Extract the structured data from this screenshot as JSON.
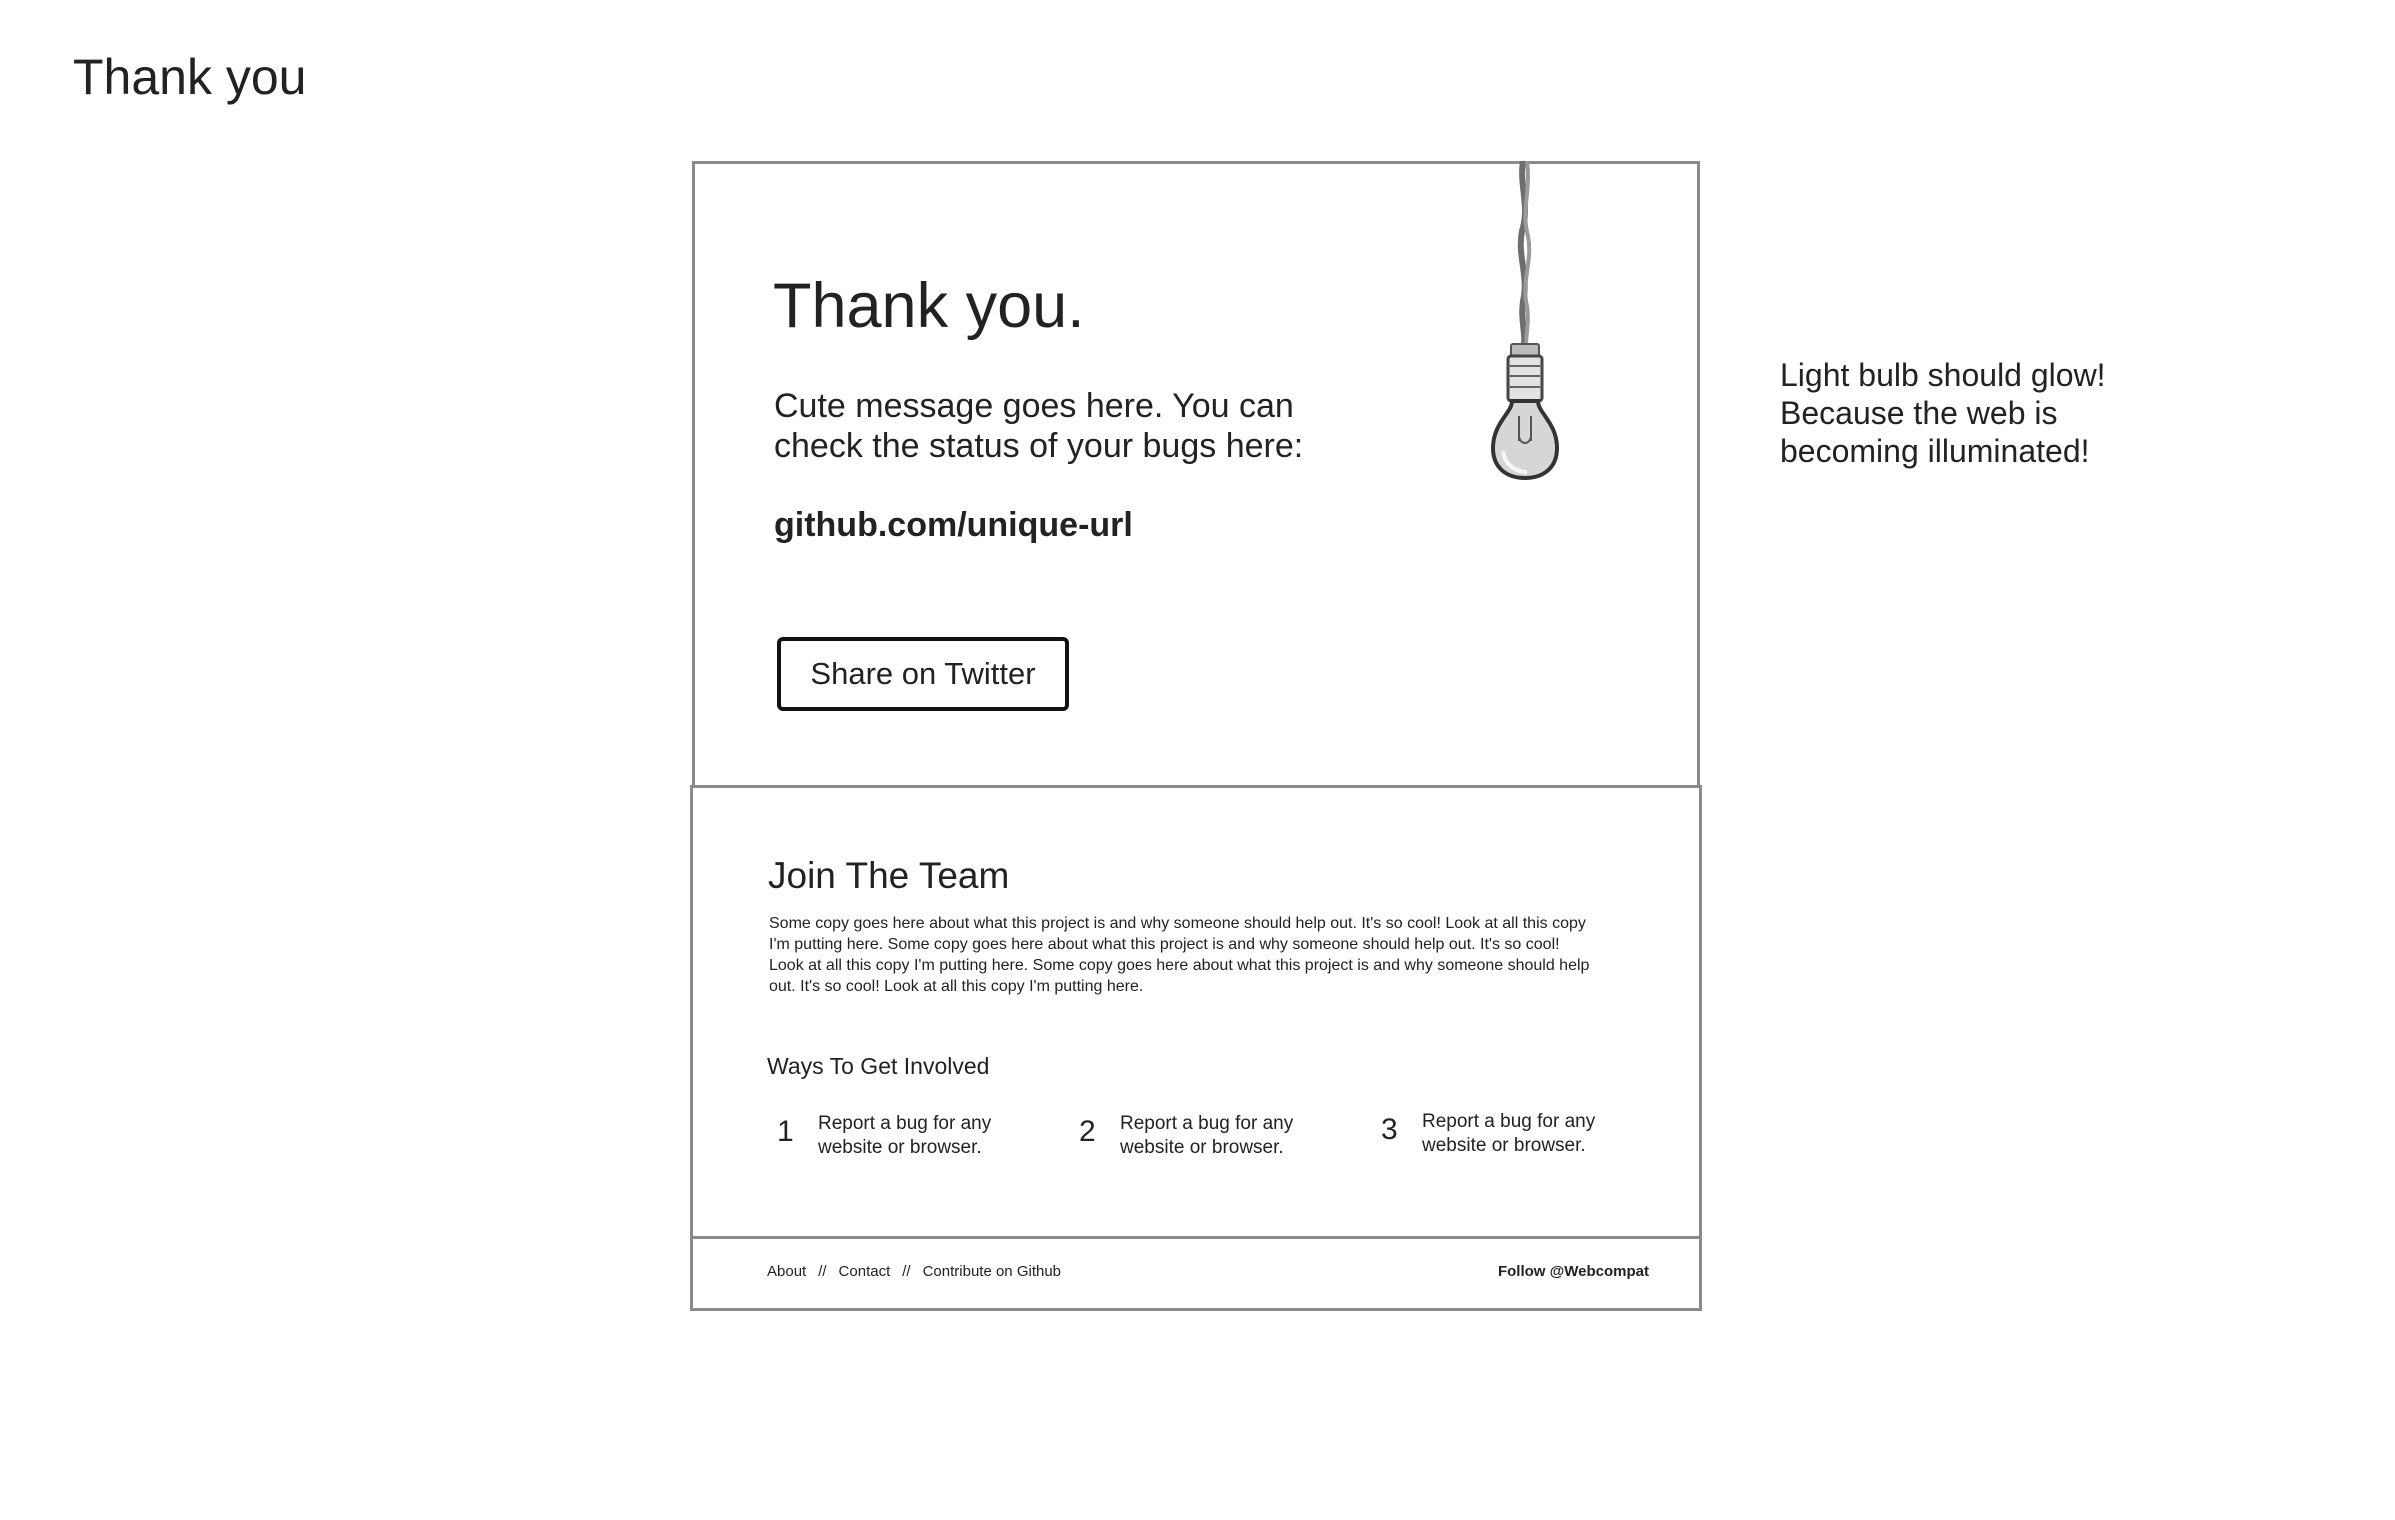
{
  "page": {
    "title": "Thank you"
  },
  "annotation": {
    "lines": [
      "Light bulb should glow!",
      "Because the web is",
      "becoming illuminated!"
    ]
  },
  "hero": {
    "heading": "Thank you.",
    "message_lines": [
      "Cute message goes here.  You can",
      "check the status of your bugs here:"
    ],
    "url": "github.com/unique-url",
    "share_button": "Share on Twitter",
    "illustration_icon": "lightbulb-icon"
  },
  "team": {
    "heading": "Join The Team",
    "copy_lines": [
      "Some copy goes here about what this project is and why someone should help out.  It's so cool!  Look at all this copy",
      "I'm putting here.  Some copy goes here about what this project is and why someone should help out.  It's so cool!",
      "Look at all this copy I'm putting here.  Some copy goes here about what this project is and why someone should help",
      "out.  It's so cool!  Look at all this copy I'm putting here."
    ],
    "ways_heading": "Ways To Get Involved",
    "ways": [
      {
        "number": "1",
        "lines": [
          "Report a bug for any",
          "website or browser."
        ]
      },
      {
        "number": "2",
        "lines": [
          "Report a bug for any",
          "website or browser."
        ]
      },
      {
        "number": "3",
        "lines": [
          "Report a bug for any",
          "website or browser."
        ]
      }
    ]
  },
  "footer": {
    "links": [
      "About",
      "Contact",
      "Contribute on Github"
    ],
    "separator": "//",
    "follow": "Follow @Webcompat"
  }
}
